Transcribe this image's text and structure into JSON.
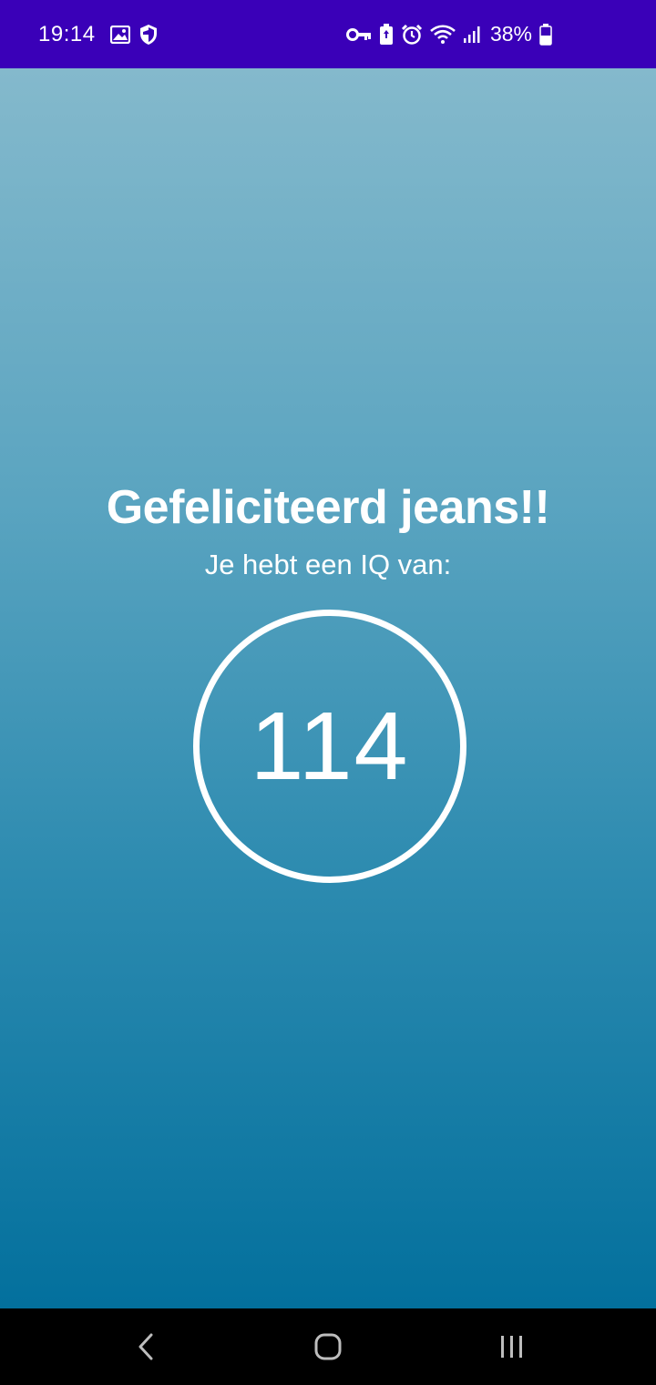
{
  "status_bar": {
    "time": "19:14",
    "battery_percent": "38%",
    "left_icons": [
      "image-icon",
      "shield-icon"
    ],
    "right_icons": [
      "vpn-key-icon",
      "battery-saver-icon",
      "alarm-icon",
      "wifi-icon",
      "signal-icon",
      "battery-icon"
    ],
    "background_color": "#3a00b8"
  },
  "main": {
    "title": "Gefeliciteerd jeans!!",
    "subtitle": "Je hebt een IQ van:",
    "score": "114",
    "gradient_top": "#84b9cc",
    "gradient_bottom": "#03709d"
  },
  "nav_bar": {
    "buttons": [
      "back-icon",
      "home-icon",
      "recents-icon"
    ]
  }
}
